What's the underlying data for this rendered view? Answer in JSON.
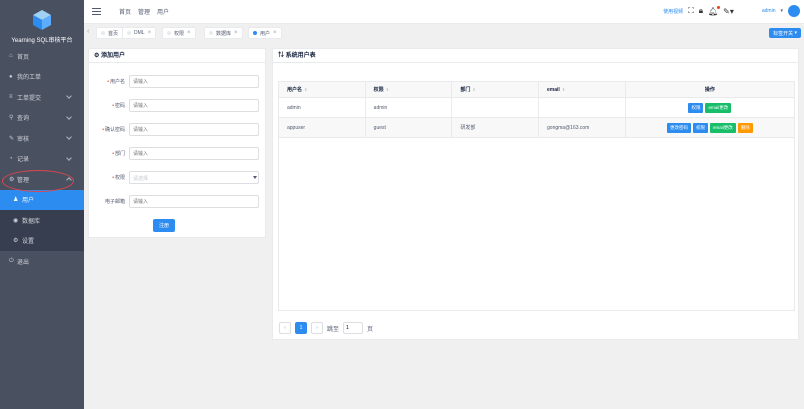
{
  "app": {
    "brand": "Yearning SQL审核平台"
  },
  "sidebar": {
    "items": [
      {
        "label": "首页",
        "icon": "home-icon",
        "glyph": "⌂"
      },
      {
        "label": "我的工单",
        "icon": "user-icon",
        "glyph": "●"
      },
      {
        "label": "工单提交",
        "icon": "menu-icon",
        "glyph": "≡"
      },
      {
        "label": "查询",
        "icon": "search-icon",
        "glyph": "⚲"
      },
      {
        "label": "审核",
        "icon": "edit-icon",
        "glyph": "✎"
      },
      {
        "label": "记录",
        "icon": "pie-icon",
        "glyph": "◔"
      },
      {
        "label": "管理",
        "icon": "settings-icon",
        "glyph": "⚙"
      }
    ],
    "sub_items": [
      {
        "label": "用户",
        "icon": "user-icon",
        "glyph": "♟"
      },
      {
        "label": "数据库",
        "icon": "database-icon",
        "glyph": "◉"
      },
      {
        "label": "设置",
        "icon": "gear-icon",
        "glyph": "⚙"
      }
    ],
    "logout": {
      "label": "退出",
      "icon": "logout-icon",
      "glyph": "⏻"
    }
  },
  "header": {
    "breadcrumbs": [
      "首页",
      "管理",
      "用户"
    ],
    "right_link": "使用视频",
    "user": "admin"
  },
  "tags": {
    "items": [
      {
        "label": "首页",
        "active": false
      },
      {
        "label": "DML",
        "active": false
      },
      {
        "label": "权限",
        "active": false
      },
      {
        "label": "数据库",
        "active": false
      },
      {
        "label": "用户",
        "active": true
      }
    ],
    "close_button": "标签开关"
  },
  "form": {
    "title": "添加用户",
    "fields": [
      {
        "label": "用户名",
        "required": true,
        "placeholder": "请输入"
      },
      {
        "label": "密码",
        "required": true,
        "placeholder": "请输入"
      },
      {
        "label": "确认密码",
        "required": true,
        "placeholder": "请输入"
      },
      {
        "label": "部门",
        "required": true,
        "placeholder": "请输入"
      },
      {
        "label": "权限",
        "required": true,
        "placeholder": "请选择"
      },
      {
        "label": "电子邮箱",
        "required": false,
        "placeholder": "请输入"
      }
    ],
    "submit_label": "注册"
  },
  "table": {
    "title": "系统用户表",
    "columns": [
      "用户名",
      "权限",
      "部门",
      "email",
      "操作"
    ],
    "rows": [
      {
        "username": "admin",
        "role": "admin",
        "dept": "",
        "email": "",
        "actions": [
          "权限",
          "email更改"
        ]
      },
      {
        "username": "appuser",
        "role": "guest",
        "dept": "研发部",
        "email": "gongma@163.com",
        "actions": [
          "更改密码",
          "权限",
          "email更改",
          "删除"
        ]
      }
    ],
    "pager": {
      "current_page": "1",
      "jump_label": "跳至",
      "jump_value": "1",
      "unit": "页"
    }
  },
  "colors": {
    "sidebar": "#495060",
    "accent": "#2d8cf0",
    "success": "#19be6b",
    "warning": "#ff9900",
    "error": "#ed4014"
  }
}
